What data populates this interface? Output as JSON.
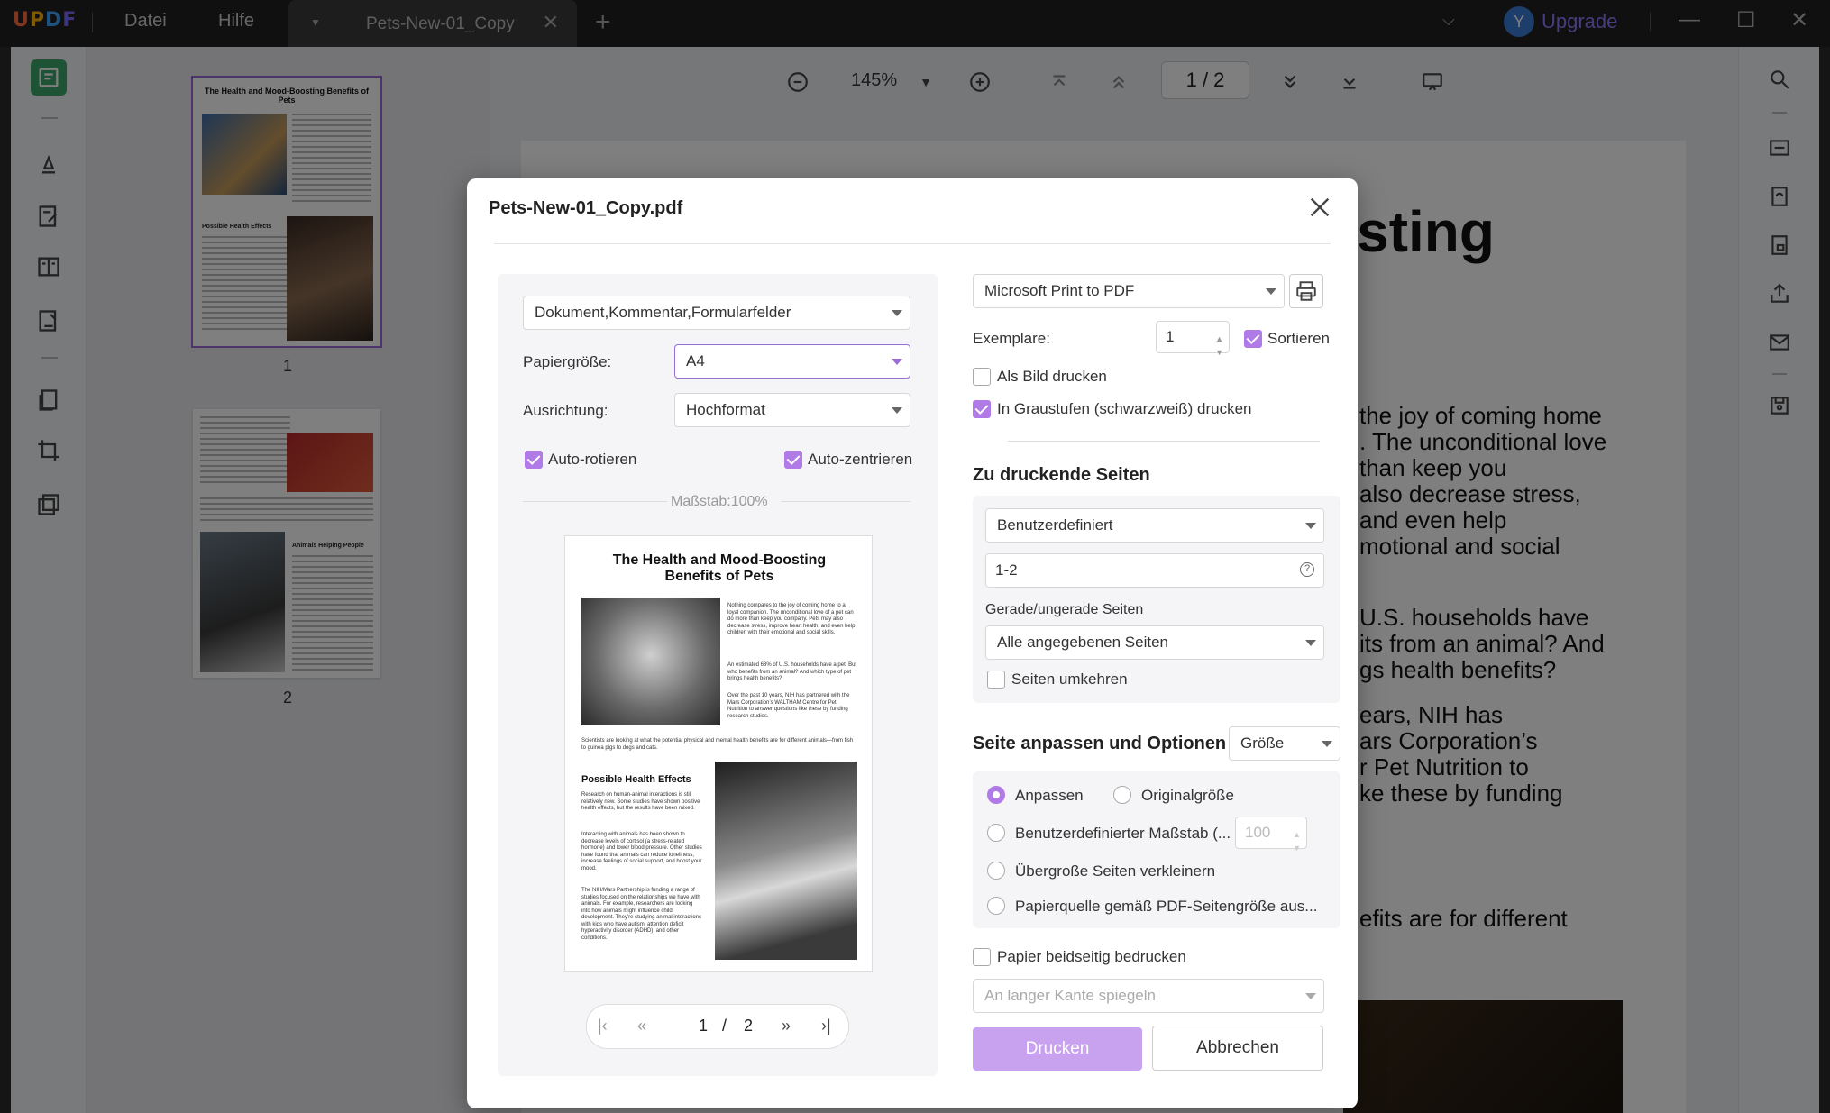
{
  "app": {
    "logo": "UPDF",
    "menu": [
      "Datei",
      "Hilfe"
    ],
    "tab_title": "Pets-New-01_Copy",
    "avatar_initial": "Y",
    "upgrade_label": "Upgrade"
  },
  "toolbar": {
    "zoom": "145%",
    "page_current": "1",
    "page_total": "2"
  },
  "thumbnails": [
    {
      "number": "1",
      "title": "The Health and Mood-Boosting Benefits of Pets",
      "heading": "Possible Health Effects"
    },
    {
      "number": "2",
      "heading": "Animals Helping People"
    }
  ],
  "background_doc": {
    "title_fragment": "osting",
    "lines": [
      "the joy of coming home",
      ". The unconditional love",
      "than keep you",
      "also decrease stress,",
      " and  even  help",
      "motional and social",
      "U.S. households have",
      "its from an animal? And",
      "gs health benefits?",
      "ears,  NIH  has",
      "ars Corporation’s",
      "r  Pet  Nutrition  to",
      "ke these by funding",
      "efits are for different"
    ]
  },
  "dialog": {
    "title": "Pets-New-01_Copy.pdf",
    "content_select": "Dokument,Kommentar,Formularfelder",
    "paper_size_label": "Papiergröße:",
    "paper_size_value": "A4",
    "orientation_label": "Ausrichtung:",
    "orientation_value": "Hochformat",
    "auto_rotate_label": "Auto-rotieren",
    "auto_rotate_checked": true,
    "auto_center_label": "Auto-zentrieren",
    "auto_center_checked": true,
    "scale_label": "Maßstab:100%",
    "preview": {
      "title": "The Health and Mood-Boosting Benefits of Pets",
      "col1": "Nothing compares to the joy of coming home to a loyal companion. The unconditional love of a pet can do more than keep you company. Pets may also decrease stress, improve heart health, and even help children with their emotional and social skills.",
      "col2": "An estimated 68% of U.S. households have a pet. But who benefits from an animal? And which type of pet brings health benefits?",
      "col3": "Over the past 10 years, NIH has partnered with the Mars Corporation’s WALTHAM Centre for Pet Nutrition to answer questions like these by funding research studies.",
      "caption": "Scientists are looking at what the potential physical and mental health benefits are for different animals—from fish to guinea pigs to dogs and cats.",
      "heading": "Possible Health Effects",
      "para1": "Research on human-animal interactions is still relatively new. Some studies have shown positive health effects, but the results have been mixed.",
      "para2": "Interacting with animals has been shown to decrease levels of cortisol (a stress-related hormone) and lower blood pressure. Other studies have found that animals can reduce loneliness, increase feelings of social support, and boost your mood.",
      "para3": "The NIH/Mars Partnership is funding a range of studies focused on the relationships we have with animals. For example, researchers are looking into how animals might influence child development. They're studying animal interactions with kids who have autism, attention deficit hyperactivity disorder (ADHD), and other conditions."
    },
    "pager": {
      "current": "1",
      "separator": "/",
      "total": "2"
    },
    "printer_value": "Microsoft Print to PDF",
    "copies_label": "Exemplare:",
    "copies_value": "1",
    "sort_label": "Sortieren",
    "sort_checked": true,
    "as_image_label": "Als Bild drucken",
    "as_image_checked": false,
    "grayscale_label": "In Graustufen (schwarzweiß) drucken",
    "grayscale_checked": true,
    "pages_heading": "Zu druckende Seiten",
    "pages_mode": "Benutzerdefiniert",
    "pages_range": "1-2",
    "even_odd_label": "Gerade/ungerade Seiten",
    "even_odd_value": "Alle angegebenen Seiten",
    "reverse_label": "Seiten umkehren",
    "reverse_checked": false,
    "fit_heading": "Seite anpassen und Optionen",
    "fit_select": "Größe",
    "fit_options": {
      "fit": "Anpassen",
      "original": "Originalgröße",
      "custom": "Benutzerdefinierter Maßstab (...",
      "custom_value": "100",
      "shrink": "Übergroße Seiten verkleinern",
      "source": "Papierquelle gemäß PDF-Seitengröße aus..."
    },
    "fit_selected": "fit",
    "duplex_label": "Papier beidseitig bedrucken",
    "duplex_checked": false,
    "duplex_select": "An langer Kante spiegeln",
    "print_button": "Drucken",
    "cancel_button": "Abbrechen"
  },
  "colors": {
    "accent": "#b07be6",
    "print_button": "#c8a2ef",
    "upgrade": "#8d7bff"
  }
}
